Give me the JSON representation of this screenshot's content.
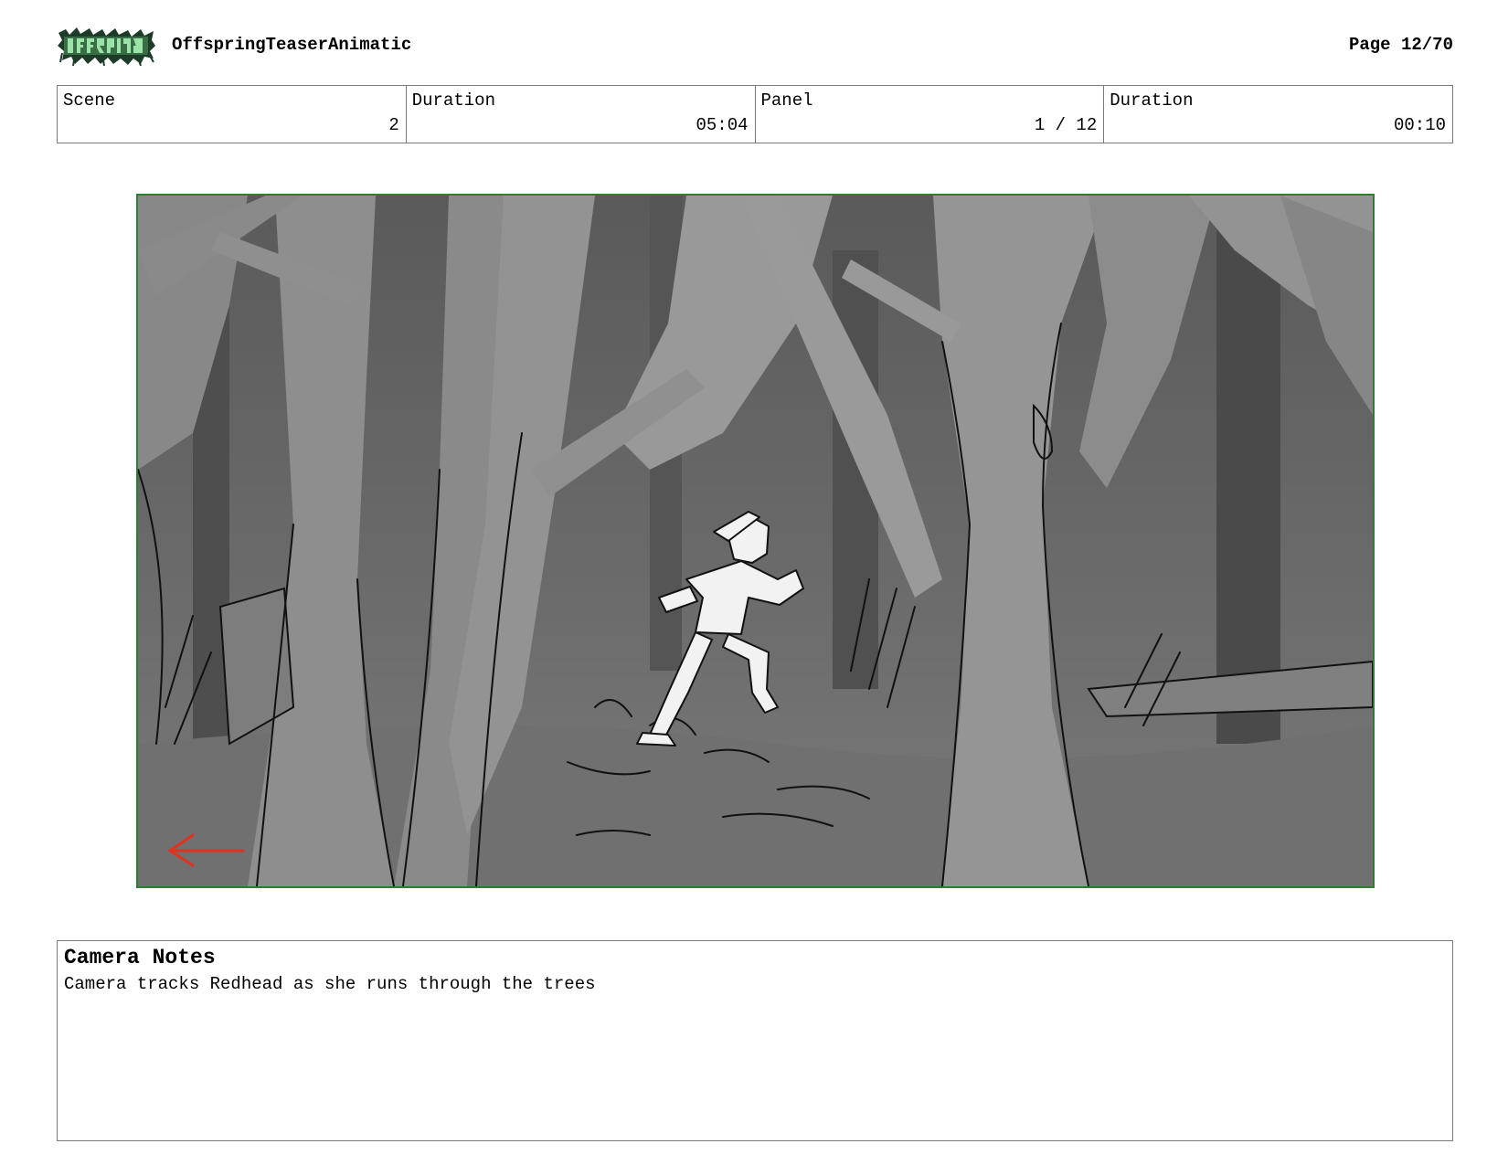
{
  "header": {
    "logo_text": "OFFSPRING",
    "title": "OffspringTeaserAnimatic",
    "page": "Page 12/70"
  },
  "info": {
    "scene_label": "Scene",
    "scene_value": "2",
    "scene_duration_label": "Duration",
    "scene_duration_value": "05:04",
    "panel_label": "Panel",
    "panel_value": "1 / 12",
    "panel_duration_label": "Duration",
    "panel_duration_value": "00:10"
  },
  "camera_notes": {
    "title": "Camera Notes",
    "text": "Camera tracks Redhead as she runs through the trees"
  },
  "colors": {
    "frame_border": "#2f7d2f",
    "arrow": "#e2321d"
  }
}
